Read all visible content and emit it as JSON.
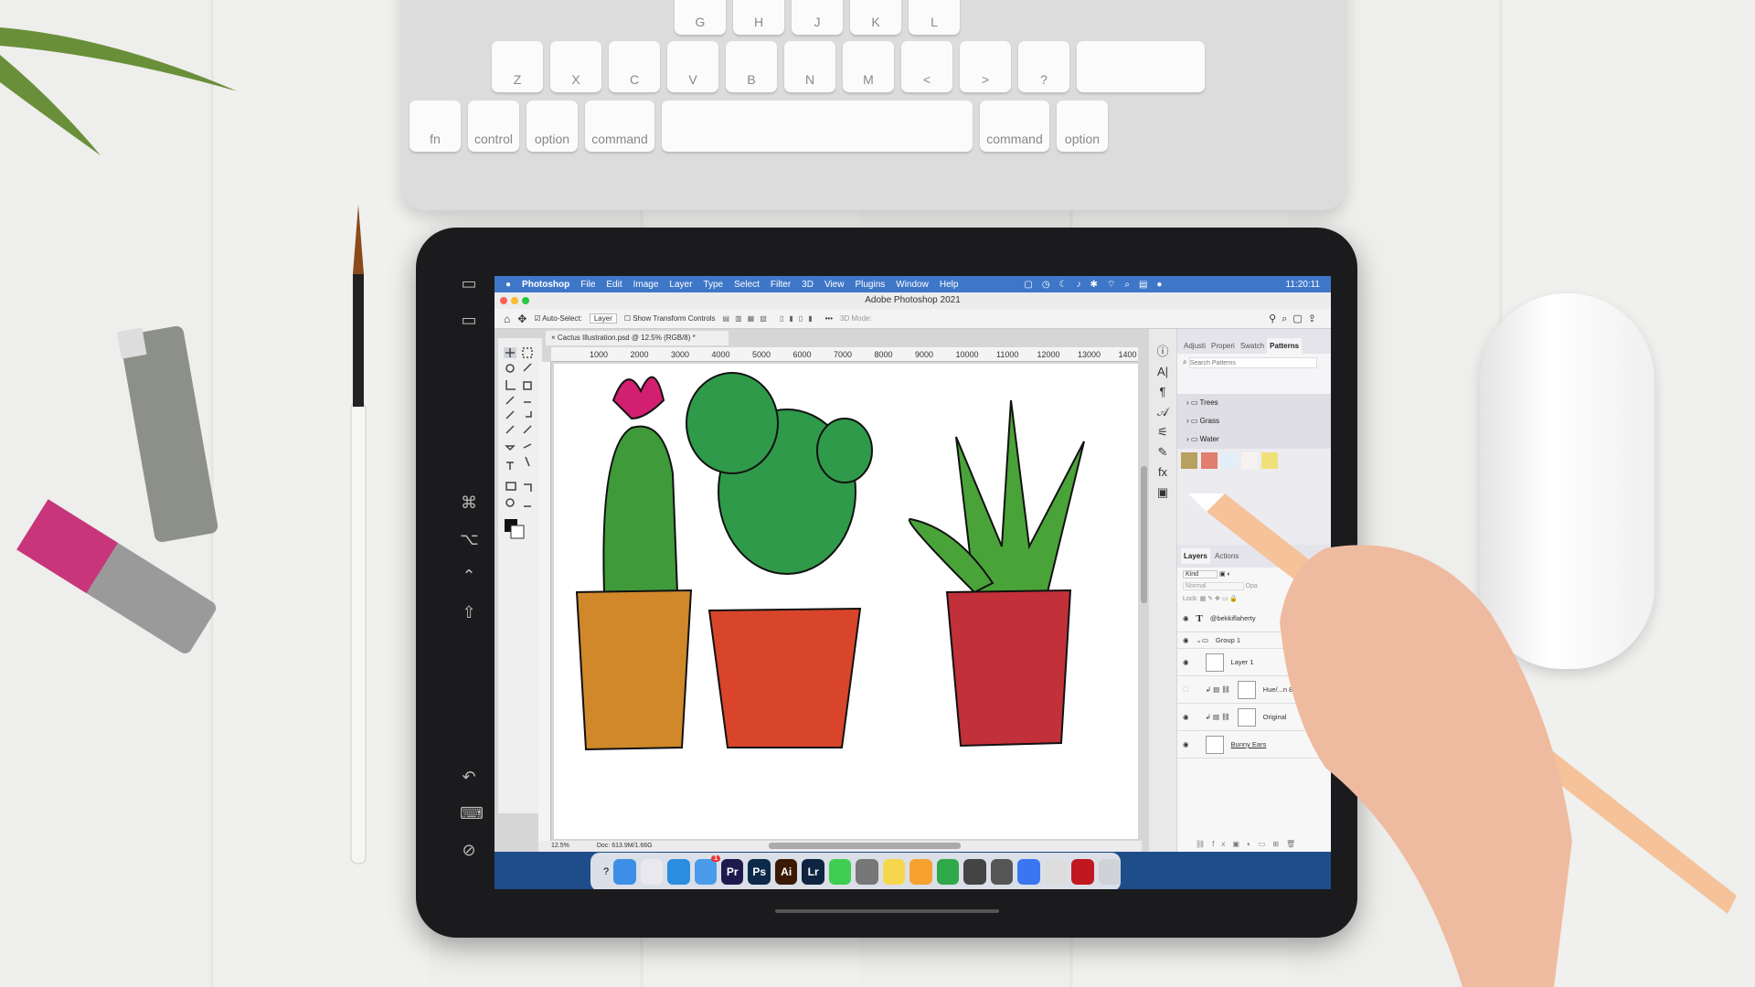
{
  "keyboard": {
    "keys": [
      "fn",
      "control",
      "option",
      "command",
      "command",
      "option",
      "Z",
      "X",
      "C",
      "V",
      "B",
      "N",
      "M",
      "<",
      ">",
      "?",
      "G",
      "H",
      "J",
      "K",
      "L"
    ]
  },
  "menubar": {
    "app": "Photoshop",
    "items": [
      "File",
      "Edit",
      "Image",
      "Layer",
      "Type",
      "Select",
      "Filter",
      "3D",
      "View",
      "Plugins",
      "Window",
      "Help"
    ],
    "clock": "11:20:11",
    "color": "#3f77c8"
  },
  "window": {
    "title": "Adobe Photoshop 2021"
  },
  "options": {
    "auto_select": "Auto-Select:",
    "layer_select": "Layer",
    "show_transform": "Show Transform Controls",
    "mode_3d": "3D Mode:"
  },
  "document": {
    "tab": "Cactus Illustration.psd @ 12.5% (RGB/8) *"
  },
  "ruler": {
    "ticks": [
      "1000",
      "2000",
      "3000",
      "4000",
      "5000",
      "6000",
      "7000",
      "8000",
      "9000",
      "10000",
      "11000",
      "12000",
      "13000",
      "1400"
    ]
  },
  "status": {
    "zoom": "12.5%",
    "doc": "Doc: 613.9M/1.66G"
  },
  "panel": {
    "tabs": [
      "Adjusti",
      "Properi",
      "Swatch",
      "Patterns"
    ],
    "search_placeholder": "Search Patterns",
    "folders": [
      "Trees",
      "Grass",
      "Water"
    ]
  },
  "layers": {
    "tabs": [
      "Layers",
      "Actions"
    ],
    "kind": "Kind",
    "blend": "Normal",
    "opacity": "Opa",
    "lock": "Lock:",
    "items": [
      {
        "name": "@bekkiflaherty",
        "type": "text",
        "visible": true
      },
      {
        "name": "Group 1",
        "type": "group",
        "visible": true
      },
      {
        "name": "Layer 1",
        "type": "pixel",
        "visible": true
      },
      {
        "name": "Hue/...n 8",
        "type": "adjustment",
        "visible": false
      },
      {
        "name": "Original",
        "type": "adjustment",
        "visible": true
      },
      {
        "name": "Bunny Ears",
        "type": "pixel",
        "visible": true
      }
    ]
  },
  "dock": {
    "apps": [
      {
        "name": "Finder",
        "label": "",
        "color": "#3d8fe6"
      },
      {
        "name": "Launchpad",
        "label": "",
        "color": "#e8e8ee"
      },
      {
        "name": "Safari",
        "label": "",
        "color": "#2a8de0"
      },
      {
        "name": "Mail",
        "label": "",
        "color": "#4a9bea",
        "badge": "1"
      },
      {
        "name": "Premiere Pro",
        "label": "Pr",
        "color": "#1f1a4e"
      },
      {
        "name": "Photoshop",
        "label": "Ps",
        "color": "#0d2a4a"
      },
      {
        "name": "Illustrator",
        "label": "Ai",
        "color": "#3a1a05"
      },
      {
        "name": "Lightroom",
        "label": "Lr",
        "color": "#0e2440"
      },
      {
        "name": "Messages",
        "label": "",
        "color": "#3fce4f"
      },
      {
        "name": "System Preferences",
        "label": "",
        "color": "#777"
      },
      {
        "name": "Notes",
        "label": "",
        "color": "#f6d64a"
      },
      {
        "name": "Pages",
        "label": "",
        "color": "#f7a230"
      },
      {
        "name": "Numbers",
        "label": "",
        "color": "#2fa84a"
      },
      {
        "name": "Calculator",
        "label": "",
        "color": "#444"
      },
      {
        "name": "Screenshot",
        "label": "",
        "color": "#555"
      },
      {
        "name": "Signal",
        "label": "",
        "color": "#3a76f0"
      },
      {
        "name": "Photo",
        "label": "",
        "color": "#ddd"
      },
      {
        "name": "Acrobat",
        "label": "",
        "color": "#c0181e"
      },
      {
        "name": "Trash",
        "label": "",
        "color": "#cfd3d8"
      }
    ]
  }
}
